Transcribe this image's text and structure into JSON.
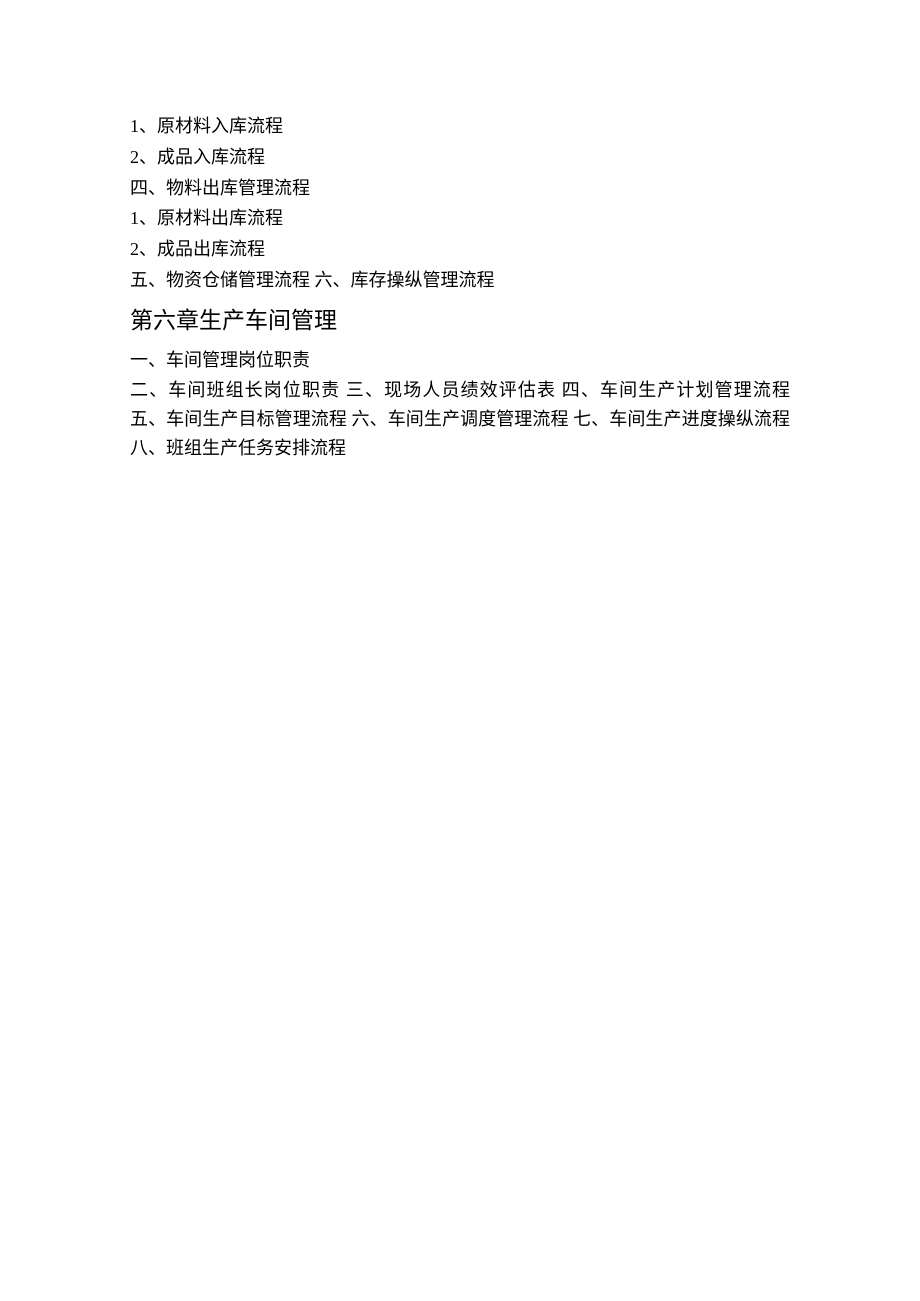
{
  "lines": {
    "l1": "1、原材料入库流程",
    "l2": "2、成品入库流程",
    "l3": "四、物料出库管理流程",
    "l4": "1、原材料出库流程",
    "l5": "2、成品出库流程",
    "l6": "五、物资仓储管理流程  六、库存操纵管理流程"
  },
  "heading": "第六章生产车间管理",
  "paragraph": {
    "p1": "一、车间管理岗位职责",
    "p2": "二、车间班组长岗位职责    三、现场人员绩效评估表    四、车间生产计划管理流程  五、车间生产目标管理流程  六、车间生产调度管理流程  七、车间生产进度操纵流程  八、班组生产任务安排流程"
  }
}
